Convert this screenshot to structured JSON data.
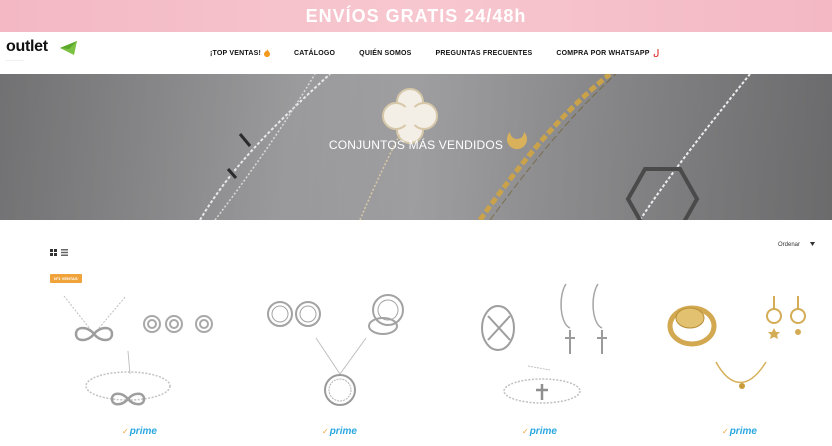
{
  "banner": {
    "text": "ENVÍOS GRATIS 24/48h"
  },
  "header": {
    "logo_text": "outlet",
    "logo_tagline": "................",
    "nav": [
      {
        "label": "¡TOP VENTAS! ",
        "icon": "fire-icon"
      },
      {
        "label": "CATÁLOGO"
      },
      {
        "label": "QUIÉN SOMOS"
      },
      {
        "label": "PREGUNTAS FRECUENTES"
      },
      {
        "label": "COMPRA POR WHATSAPP",
        "icon": "whatsapp-icon"
      }
    ]
  },
  "hero": {
    "title": "CONJUNTOS MÁS VENDIDOS"
  },
  "toolbar": {
    "view_icons": [
      "grid-view-icon",
      "list-view-icon"
    ],
    "sort_label": "Ordenar"
  },
  "products": [
    {
      "badge": "Nº1 VENTAS",
      "prime_label": "prime",
      "image": "infinity-necklace-earrings-bracelet-set"
    },
    {
      "prime_label": "prime",
      "image": "tree-of-life-necklace-earrings-ring-set"
    },
    {
      "prime_label": "prime",
      "image": "cross-earrings-ring-bracelet-set"
    },
    {
      "prime_label": "prime",
      "image": "gold-signet-ring-earrings-necklace-set"
    }
  ],
  "colors": {
    "banner_bg": "#f3b8c4",
    "badge_bg": "#f0a33a",
    "prime_blue": "#2aa6e0",
    "logo_green": "#7cc242"
  }
}
